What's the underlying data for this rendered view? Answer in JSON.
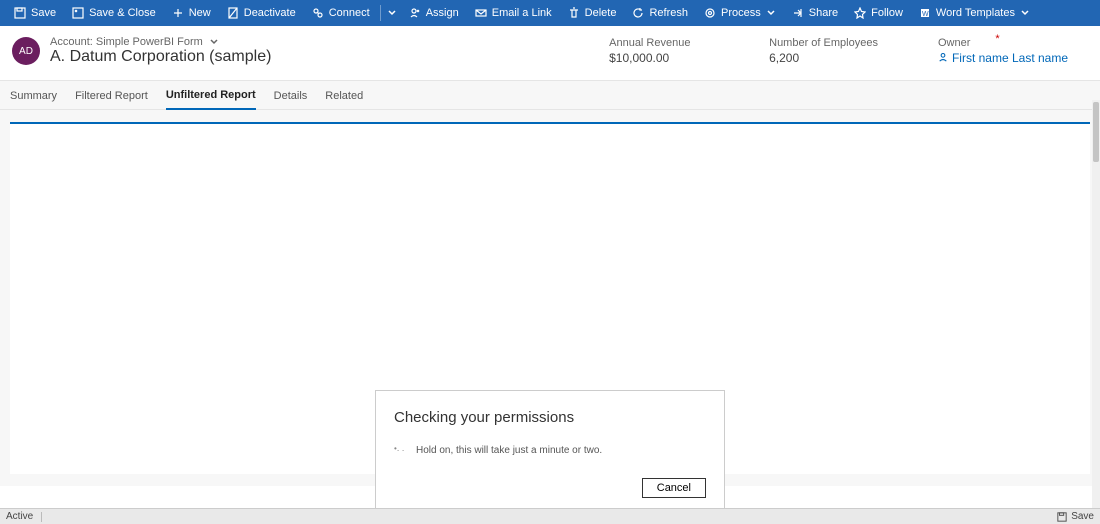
{
  "commandBar": {
    "save": "Save",
    "saveClose": "Save & Close",
    "new": "New",
    "deactivate": "Deactivate",
    "connect": "Connect",
    "assign": "Assign",
    "emailLink": "Email a Link",
    "delete": "Delete",
    "refresh": "Refresh",
    "process": "Process",
    "share": "Share",
    "follow": "Follow",
    "wordTemplates": "Word Templates"
  },
  "record": {
    "avatarInitials": "AD",
    "typeLabel": "Account: Simple PowerBI Form",
    "title": "A. Datum Corporation (sample)"
  },
  "headerFields": {
    "annualRevenue": {
      "label": "Annual Revenue",
      "value": "$10,000.00"
    },
    "numEmployees": {
      "label": "Number of Employees",
      "value": "6,200"
    },
    "owner": {
      "label": "Owner",
      "value": "First name Last name",
      "required": "*"
    }
  },
  "tabs": {
    "summary": "Summary",
    "filtered": "Filtered Report",
    "unfiltered": "Unfiltered Report",
    "details": "Details",
    "related": "Related"
  },
  "dialog": {
    "title": "Checking your permissions",
    "body": "Hold on, this will take just a minute or two.",
    "cancel": "Cancel"
  },
  "statusBar": {
    "state": "Active",
    "save": "Save"
  }
}
